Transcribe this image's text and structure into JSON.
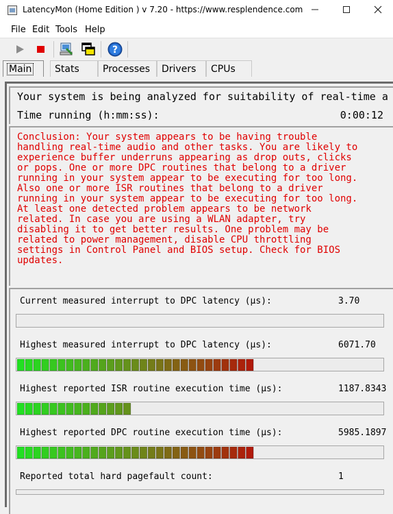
{
  "window": {
    "title": "LatencyMon  (Home Edition )  v 7.20 - https://www.resplendence.com"
  },
  "menu": [
    "File",
    "Edit",
    "Tools",
    "Help"
  ],
  "toolbar": {
    "icons": [
      "play-icon",
      "stop-icon",
      "computer-info-icon",
      "windows-icon",
      "help-icon"
    ],
    "colors": {
      "stop": "#e00000",
      "play": "#8c8c8c",
      "help": "#1e5bb8"
    }
  },
  "tabs": [
    "Main",
    "Stats",
    "Processes",
    "Drivers",
    "CPUs"
  ],
  "status": {
    "analyzing": "Your system is being analyzed for suitability of real-time a",
    "time_label": "Time running (h:mm:ss):",
    "time_value": "0:00:12"
  },
  "conclusion": "Conclusion: Your system appears to be having trouble\nhandling real-time audio and other tasks. You are likely to\nexperience buffer underruns appearing as drop outs, clicks\nor pops. One or more DPC routines that belong to a driver\nrunning in your system appear to be executing for too long.\nAlso one or more ISR routines that belong to a driver\nrunning in your system appear to be executing for too long.\nAt least one detected problem appears to be network\nrelated. In case you are using a WLAN adapter, try\ndisabling it to get better results. One problem may be\nrelated to power management, disable CPU throttling\nsettings in Control Panel and BIOS setup. Check for BIOS\nupdates.",
  "conclusion_color": "#e00000",
  "metrics": [
    {
      "label": "Current measured interrupt to DPC latency (µs):",
      "value": "3.70",
      "segments": 0
    },
    {
      "label": "Highest measured interrupt to DPC latency (µs):",
      "value": "6071.70",
      "segments": 29
    },
    {
      "label": "Highest reported ISR routine execution time (µs):",
      "value": "1187.8343",
      "segments": 14
    },
    {
      "label": "Highest reported DPC routine execution time (µs):",
      "value": "5985.1897",
      "segments": 29
    },
    {
      "label": "Reported total hard pagefault count:",
      "value": "1",
      "segments": 0
    }
  ],
  "meter_colors": {
    "start": "#22e022",
    "mid": "#6a8c1a",
    "end": "#b01a0a"
  }
}
